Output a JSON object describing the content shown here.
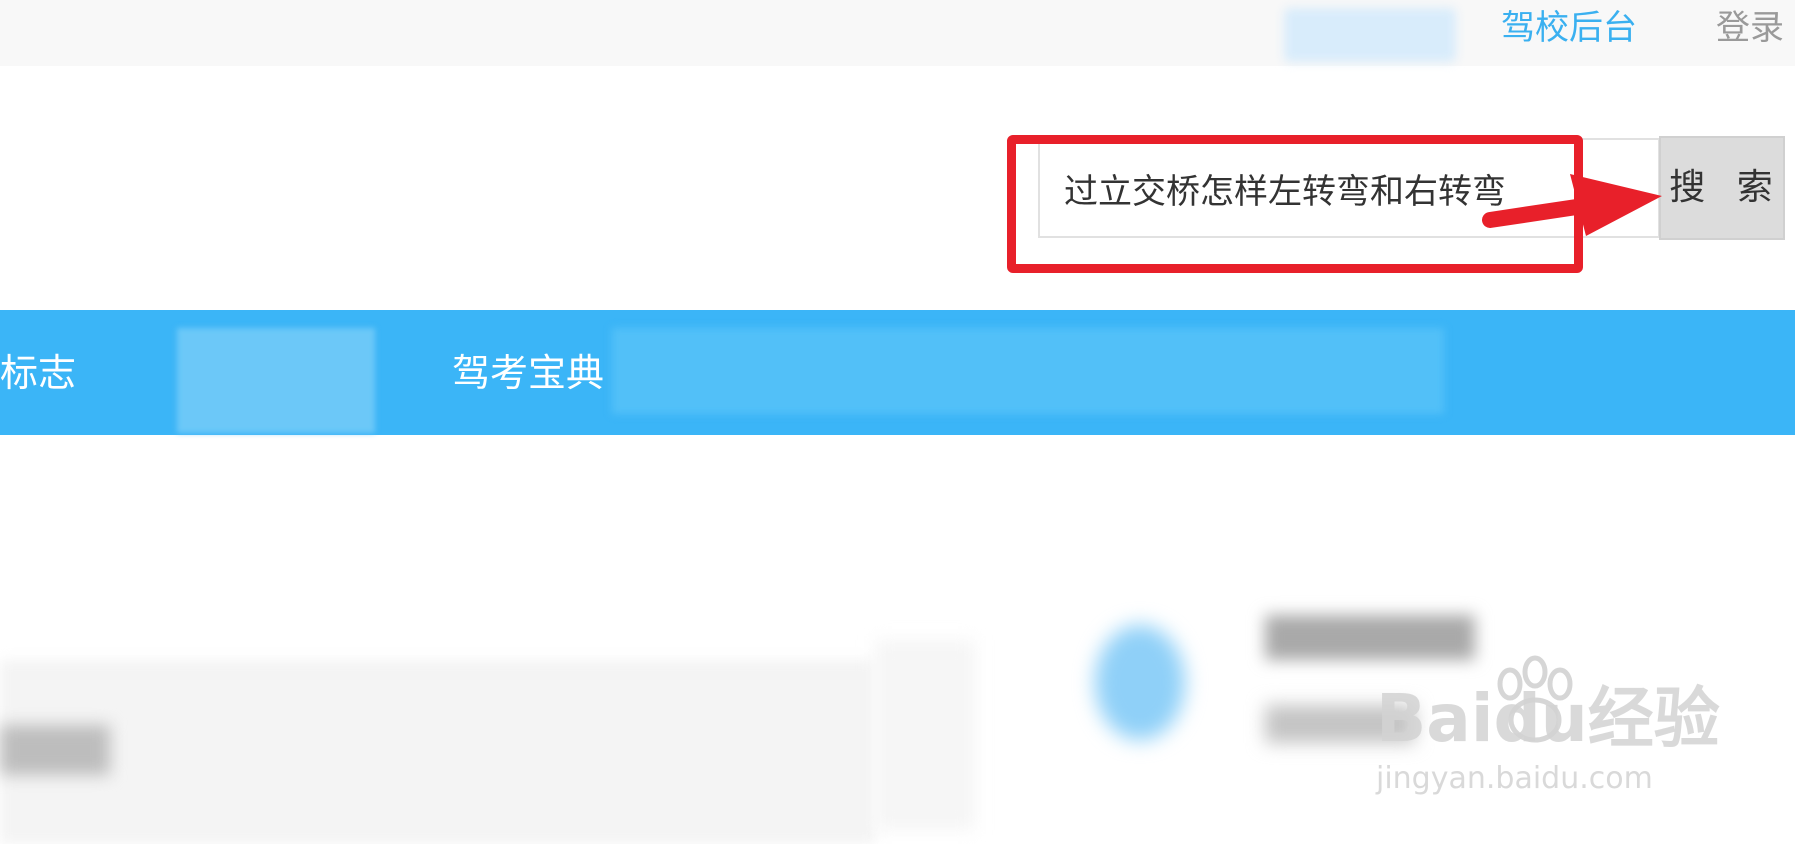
{
  "topbar": {
    "school_admin_link": "驾校后台",
    "login_link": "登录"
  },
  "search": {
    "value": "过立交桥怎样左转弯和右转弯",
    "button_label": "搜 索"
  },
  "nav": {
    "items": [
      {
        "label": "标志"
      },
      {
        "label": "驾考宝典"
      }
    ]
  },
  "watermark": {
    "logo_text": "Baidu经验",
    "url": "jingyan.baidu.com"
  },
  "colors": {
    "accent_blue": "#3bb5f7",
    "link_blue": "#3ab0f0",
    "annotation_red": "#e8202a"
  },
  "icons": {
    "annotation_arrow": "arrow-right-icon",
    "watermark_paw": "paw-icon"
  }
}
